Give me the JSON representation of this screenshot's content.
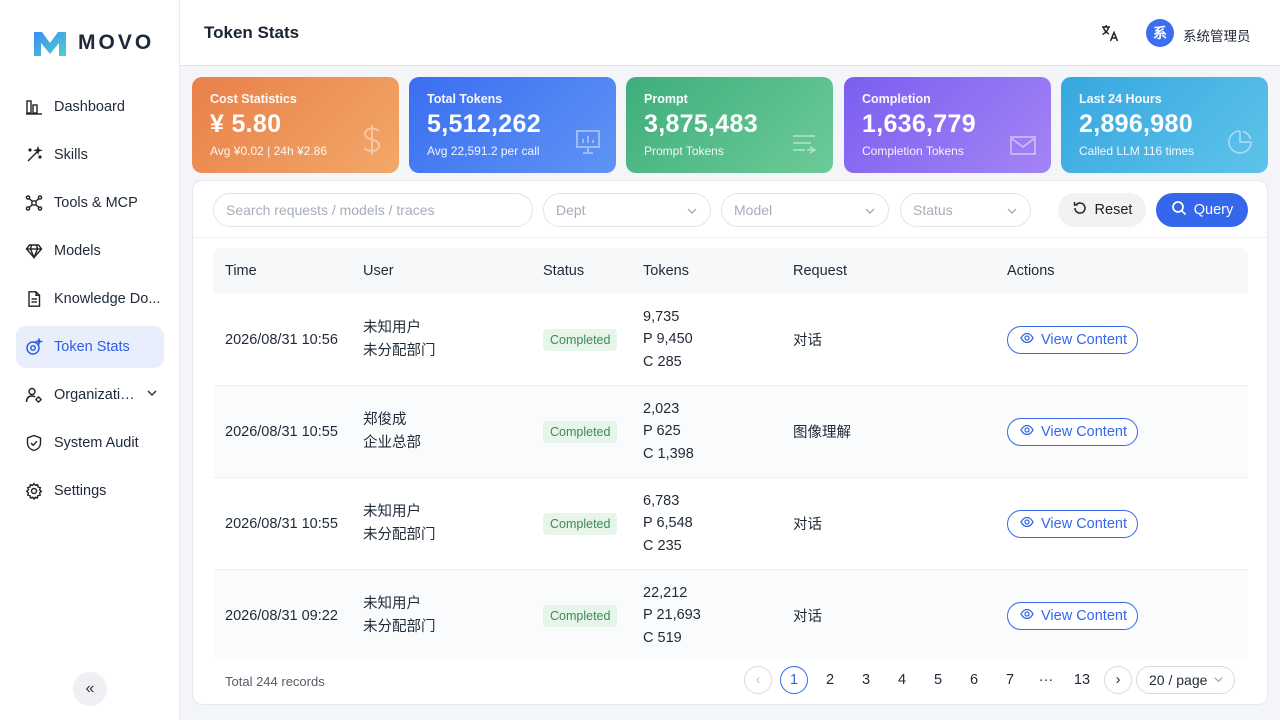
{
  "app": {
    "logo_text": "MOVO"
  },
  "sidebar": {
    "items": [
      {
        "label": "Dashboard",
        "icon": "bar-chart-icon"
      },
      {
        "label": "Skills",
        "icon": "magic-wand-icon"
      },
      {
        "label": "Tools & MCP",
        "icon": "network-icon"
      },
      {
        "label": "Models",
        "icon": "diamond-icon"
      },
      {
        "label": "Knowledge Do...",
        "icon": "document-icon"
      },
      {
        "label": "Token Stats",
        "icon": "token-icon",
        "active": true
      },
      {
        "label": "Organizatio...",
        "icon": "org-icon",
        "expandable": true
      },
      {
        "label": "System Audit",
        "icon": "shield-icon"
      },
      {
        "label": "Settings",
        "icon": "gear-icon"
      }
    ],
    "collapse_label": "«"
  },
  "header": {
    "title": "Token Stats",
    "user_initial": "系",
    "user_name": "系统管理员"
  },
  "cards": [
    {
      "title": "Cost Statistics",
      "value": "¥ 5.80",
      "sub": "Avg ¥0.02 | 24h ¥2.86",
      "color_from": "#e9804a",
      "color_to": "#f2a868",
      "icon": "dollar-icon"
    },
    {
      "title": "Total Tokens",
      "value": "5,512,262",
      "sub": "Avg 22,591.2 per call",
      "color_from": "#3a6ef0",
      "color_to": "#5f94f5",
      "icon": "presentation-icon"
    },
    {
      "title": "Prompt",
      "value": "3,875,483",
      "sub": "Prompt Tokens",
      "color_from": "#3fae7c",
      "color_to": "#6ccb98",
      "icon": "list-arrow-icon"
    },
    {
      "title": "Completion",
      "value": "1,636,779",
      "sub": "Completion Tokens",
      "color_from": "#7b5ef0",
      "color_to": "#a484f5",
      "icon": "mail-icon"
    },
    {
      "title": "Last 24 Hours",
      "value": "2,896,980",
      "sub": "Called LLM 116 times",
      "color_from": "#36a7e0",
      "color_to": "#5ec3ea",
      "icon": "pie-icon"
    }
  ],
  "filters": {
    "search_placeholder": "Search requests / models / traces",
    "dept_placeholder": "Dept",
    "model_placeholder": "Model",
    "status_placeholder": "Status",
    "reset_label": "Reset",
    "query_label": "Query"
  },
  "table": {
    "columns": [
      "Time",
      "User",
      "Status",
      "Tokens",
      "Request",
      "Actions"
    ],
    "rows": [
      {
        "time": "2026/08/31 10:56",
        "user": "未知用户",
        "dept": "未分配部门",
        "status": "Completed",
        "total": "9,735",
        "prompt": "P 9,450",
        "completion": "C 285",
        "request": "对话",
        "action": "View Content"
      },
      {
        "time": "2026/08/31 10:55",
        "user": "郑俊成",
        "dept": "企业总部",
        "status": "Completed",
        "total": "2,023",
        "prompt": "P 625",
        "completion": "C 1,398",
        "request": "图像理解",
        "action": "View Content"
      },
      {
        "time": "2026/08/31 10:55",
        "user": "未知用户",
        "dept": "未分配部门",
        "status": "Completed",
        "total": "6,783",
        "prompt": "P 6,548",
        "completion": "C 235",
        "request": "对话",
        "action": "View Content"
      },
      {
        "time": "2026/08/31 09:22",
        "user": "未知用户",
        "dept": "未分配部门",
        "status": "Completed",
        "total": "22,212",
        "prompt": "P 21,693",
        "completion": "C 519",
        "request": "对话",
        "action": "View Content"
      }
    ]
  },
  "pagination": {
    "total_text": "Total 244 records",
    "pages": [
      "1",
      "2",
      "3",
      "4",
      "5",
      "6",
      "7",
      "···",
      "13"
    ],
    "current": "1",
    "prev": "‹",
    "next": "›",
    "page_size": "20 / page"
  }
}
